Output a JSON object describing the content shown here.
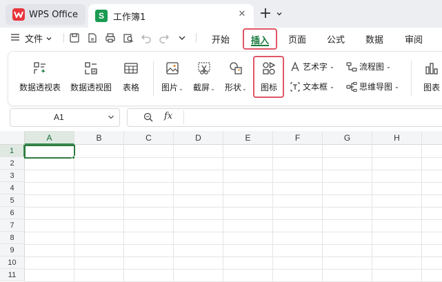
{
  "titlebar": {
    "app_tab": "WPS Office",
    "doc_tab": "工作簿1",
    "doc_badge": "S",
    "close_glyph": "✕",
    "new_tab_glyph": "+"
  },
  "menubar": {
    "file": "文件",
    "items": [
      "开始",
      "插入",
      "页面",
      "公式",
      "数据",
      "审阅"
    ],
    "active": "插入"
  },
  "ribbon": {
    "pivot_table": "数据透视表",
    "pivot_chart": "数据透视图",
    "table": "表格",
    "picture": "图片",
    "screenshot": "截屏",
    "shapes": "形状",
    "icons": "图标",
    "wordart": "艺术字",
    "textbox": "文本框",
    "flowchart": "流程图",
    "mindmap": "思维导图",
    "chart": "图表"
  },
  "formula_bar": {
    "cell_ref": "A1",
    "fx": "fx",
    "value": ""
  },
  "sheet": {
    "columns": [
      "A",
      "B",
      "C",
      "D",
      "E",
      "F",
      "G",
      "H"
    ],
    "rows": [
      "1",
      "2",
      "3",
      "4",
      "5",
      "6",
      "7",
      "8",
      "9",
      "10",
      "11"
    ],
    "active_cell": "A1"
  },
  "colors": {
    "accent_green": "#1a7a3f",
    "highlight_red": "#e05565",
    "sheet_badge": "#1a9a52"
  }
}
